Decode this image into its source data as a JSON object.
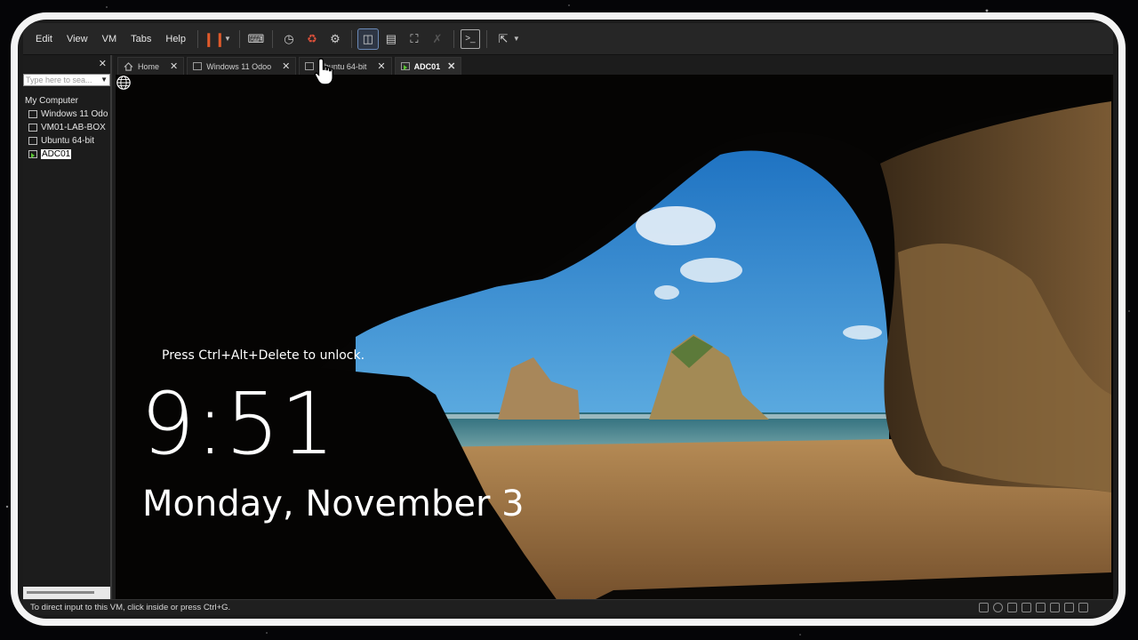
{
  "menubar": {
    "items": [
      "Edit",
      "View",
      "VM",
      "Tabs",
      "Help"
    ]
  },
  "library": {
    "search_placeholder": "Type here to sea...",
    "root_label": "My Computer",
    "vms": [
      "Windows 11 Odo",
      "VM01-LAB-BOX",
      "Ubuntu 64-bit",
      "ADC01"
    ],
    "selected_vm": "ADC01"
  },
  "tabs": [
    {
      "label": "Home"
    },
    {
      "label": "Windows 11 Odoo"
    },
    {
      "label": "Ubuntu 64-bit"
    },
    {
      "label": "ADC01"
    }
  ],
  "lockscreen": {
    "hint": "Press Ctrl+Alt+Delete to unlock.",
    "time": "9:51",
    "date": "Monday, November 3"
  },
  "statusbar": {
    "text": "To direct input to this VM, click inside or press Ctrl+G."
  },
  "colors": {
    "accent_running": "#58c431",
    "pause": "#e05a2b",
    "frame": "#f4f4f4"
  }
}
